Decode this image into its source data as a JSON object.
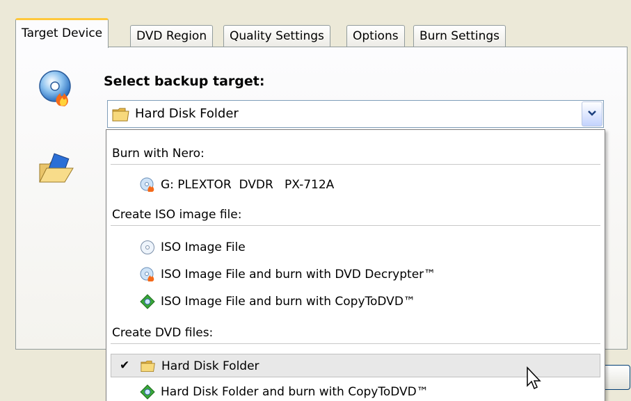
{
  "tabs": [
    {
      "label": "Target Device",
      "active": true
    },
    {
      "label": "DVD Region",
      "active": false
    },
    {
      "label": "Quality Settings",
      "active": false
    },
    {
      "label": "Options",
      "active": false
    },
    {
      "label": "Burn Settings",
      "active": false
    }
  ],
  "panel": {
    "heading": "Select backup target:",
    "combo_value": "Hard Disk Folder",
    "combo_icon": "folder-icon"
  },
  "dropdown": {
    "groups": [
      {
        "header": "Burn with Nero:",
        "items": [
          {
            "label": "G: PLEXTOR  DVDR   PX-712A",
            "icon": "nero-disc-icon"
          }
        ]
      },
      {
        "header": "Create ISO image file:",
        "items": [
          {
            "label": "ISO Image File",
            "icon": "iso-disc-icon"
          },
          {
            "label": "ISO Image File and burn with DVD Decrypter™",
            "icon": "dvd-decrypter-icon"
          },
          {
            "label": "ISO Image File and burn with CopyToDVD™",
            "icon": "copytodvd-icon"
          }
        ]
      },
      {
        "header": "Create DVD files:",
        "items": [
          {
            "label": "Hard Disk Folder",
            "icon": "folder-icon",
            "selected": true
          },
          {
            "label": "Hard Disk Folder and burn with CopyToDVD™",
            "icon": "copytodvd-icon"
          }
        ]
      }
    ],
    "checkmark": "✔"
  },
  "colors": {
    "tab_highlight": "#ffc83c",
    "window_bg": "#ece9d8",
    "selection_bg": "#e8e8e8"
  }
}
